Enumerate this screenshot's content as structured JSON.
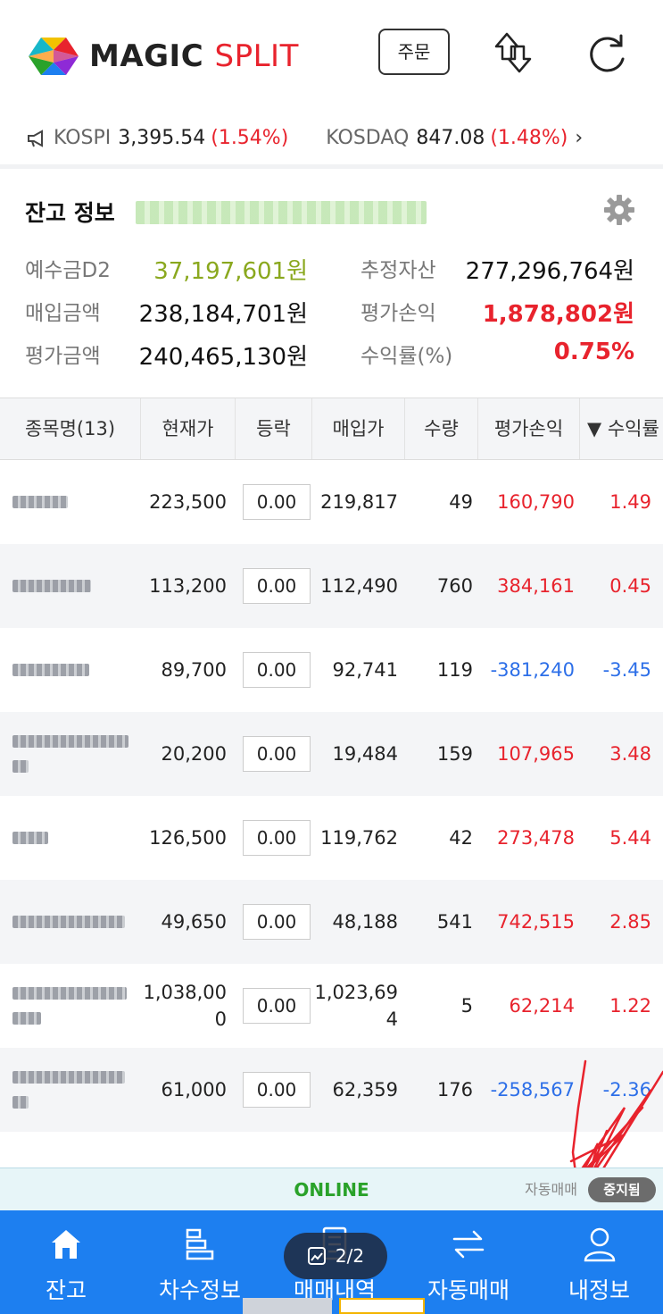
{
  "app": {
    "brand_magic": "MAGIC",
    "brand_split": "SPLIT",
    "order_button": "주문"
  },
  "ticker": {
    "kospi_name": "KOSPI",
    "kospi_value": "3,395.54",
    "kospi_change": "(1.54%)",
    "kosdaq_name": "KOSDAQ",
    "kosdaq_value": "847.08",
    "kosdaq_change": "(1.48%)",
    "chevron": "›"
  },
  "balance": {
    "title": "잔고 정보",
    "deposit_label": "예수금D2",
    "deposit_value": "37,197,601원",
    "est_assets_label": "추정자산",
    "est_assets_value": "277,296,764원",
    "purchase_label": "매입금액",
    "purchase_value": "238,184,701원",
    "eval_pl_label": "평가손익",
    "eval_pl_value": "1,878,802원",
    "eval_amount_label": "평가금액",
    "eval_amount_value": "240,465,130원",
    "return_label": "수익률(%)",
    "return_value": "0.75%"
  },
  "table": {
    "headers": [
      "종목명(13)",
      "현재가",
      "등락",
      "매입가",
      "수량",
      "평가손익",
      "▼ 수익률"
    ],
    "rows": [
      {
        "current": "223,500",
        "change": "0.00",
        "buy": "219,817",
        "qty": "49",
        "pl": "160,790",
        "rate": "1.49",
        "sign": "pos"
      },
      {
        "current": "113,200",
        "change": "0.00",
        "buy": "112,490",
        "qty": "760",
        "pl": "384,161",
        "rate": "0.45",
        "sign": "pos"
      },
      {
        "current": "89,700",
        "change": "0.00",
        "buy": "92,741",
        "qty": "119",
        "pl": "-381,240",
        "rate": "-3.45",
        "sign": "neg"
      },
      {
        "current": "20,200",
        "change": "0.00",
        "buy": "19,484",
        "qty": "159",
        "pl": "107,965",
        "rate": "3.48",
        "sign": "pos"
      },
      {
        "current": "126,500",
        "change": "0.00",
        "buy": "119,762",
        "qty": "42",
        "pl": "273,478",
        "rate": "5.44",
        "sign": "pos"
      },
      {
        "current": "49,650",
        "change": "0.00",
        "buy": "48,188",
        "qty": "541",
        "pl": "742,515",
        "rate": "2.85",
        "sign": "pos"
      },
      {
        "current_a": "1,038,00",
        "current_b": "0",
        "change": "0.00",
        "buy_a": "1,023,69",
        "buy_b": "4",
        "qty": "5",
        "pl": "62,214",
        "rate": "1.22",
        "sign": "pos"
      },
      {
        "current": "61,000",
        "change": "0.00",
        "buy": "62,359",
        "qty": "176",
        "pl": "-258,567",
        "rate": "-2.36",
        "sign": "neg"
      }
    ]
  },
  "status": {
    "online": "ONLINE",
    "auto_trade_label": "자동매매",
    "auto_trade_state": "중지됨"
  },
  "nav": {
    "items": [
      {
        "label": "잔고",
        "icon": "home-icon"
      },
      {
        "label": "차수정보",
        "icon": "list-steps-icon"
      },
      {
        "label": "매매내역",
        "icon": "document-icon"
      },
      {
        "label": "자동매매",
        "icon": "swap-arrows-icon"
      },
      {
        "label": "내정보",
        "icon": "user-icon"
      }
    ],
    "pager": "2/2"
  },
  "colors": {
    "accent": "#1d7ff0",
    "up": "#e8232d",
    "down": "#2d6fe8",
    "deposit": "#8aa81e",
    "online": "#2aa22a"
  }
}
